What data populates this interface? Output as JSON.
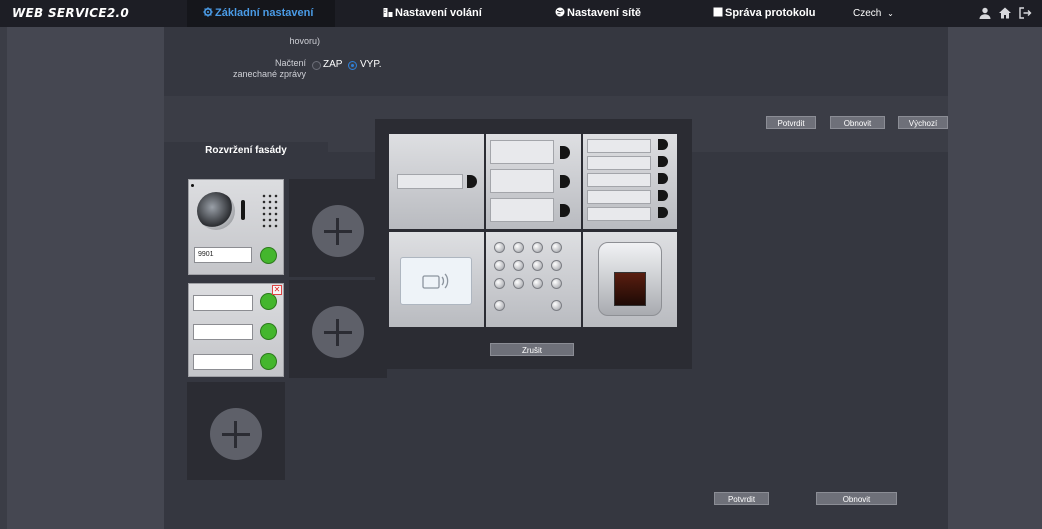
{
  "header": {
    "logo": "WEB SERVICE2.0",
    "nav": [
      {
        "label": "Základní nastavení",
        "active": true
      },
      {
        "label": "Nastavení volání",
        "active": false
      },
      {
        "label": "Nastavení sítě",
        "active": false
      },
      {
        "label": "Správa protokolu",
        "active": false
      }
    ],
    "language": "Czech"
  },
  "settings": {
    "truncated_label": "hovoru)",
    "message_label": "Načtení zanechané zprávy",
    "options": [
      "ZAP",
      "VYP."
    ],
    "selected": "VYP."
  },
  "buttons_top": {
    "confirm": "Potvrdit",
    "refresh": "Obnovit",
    "default": "Výchozí"
  },
  "facade": {
    "tab_label": "Rozvržení fasády",
    "camera_number": "9901"
  },
  "popup": {
    "cancel": "Zrušit"
  },
  "buttons_bottom": {
    "confirm": "Potvrdit",
    "refresh": "Obnovit"
  },
  "colors": {
    "accent": "#4a9be6",
    "led": "#44b62d",
    "background": "#3b3d46"
  }
}
